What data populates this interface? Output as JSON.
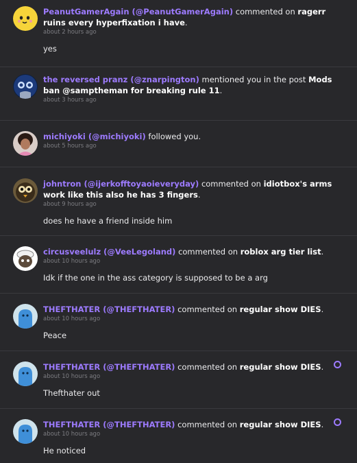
{
  "notifications": [
    {
      "user": "PeanutGamerAgain (@PeanutGamerAgain)",
      "action": "commented on",
      "post": "ragerr ruins every hyperfixation i have",
      "end": ".",
      "time": "about 2 hours ago",
      "body": "yes",
      "avatar": "peanut-avatar",
      "unread": false
    },
    {
      "user": "the reversed pranz (@znarpington)",
      "action": "mentioned you in the post",
      "post": "Mods ban @samptheman for breaking rule 11",
      "end": ".",
      "time": "about 3 hours ago",
      "body": "",
      "avatar": "pranz-avatar",
      "unread": false
    },
    {
      "user": "michiyoki (@michiyoki)",
      "action": "followed you.",
      "post": "",
      "end": "",
      "time": "about 5 hours ago",
      "body": "",
      "avatar": "michiyoki-avatar",
      "unread": false
    },
    {
      "user": "johntron (@ijerkofftoyaoieveryday)",
      "action": "commented on",
      "post": "idiotbox's arms work like this also he has 3 fingers",
      "end": ".",
      "time": "about 9 hours ago",
      "body": "does he have a friend inside him",
      "avatar": "johntron-avatar",
      "unread": false
    },
    {
      "user": "circusveelulz (@VeeLegoland)",
      "action": "commented on",
      "post": "roblox arg tier list",
      "end": ".",
      "time": "about 10 hours ago",
      "body": "Idk if the one in the ass category is supposed to be a arg",
      "avatar": "circusveelulz-avatar",
      "unread": false
    },
    {
      "user": "THEFTHATER (@THEFTHATER)",
      "action": "commented on",
      "post": "regular show DIES",
      "end": ".",
      "time": "about 10 hours ago",
      "body": "Peace",
      "avatar": "thefthater-avatar",
      "unread": false
    },
    {
      "user": "THEFTHATER (@THEFTHATER)",
      "action": "commented on",
      "post": "regular show DIES",
      "end": ".",
      "time": "about 10 hours ago",
      "body": "Thefthater out",
      "avatar": "thefthater-avatar",
      "unread": true
    },
    {
      "user": "THEFTHATER (@THEFTHATER)",
      "action": "commented on",
      "post": "regular show DIES",
      "end": ".",
      "time": "about 10 hours ago",
      "body": "He noticed",
      "avatar": "thefthater-avatar",
      "unread": true
    }
  ]
}
